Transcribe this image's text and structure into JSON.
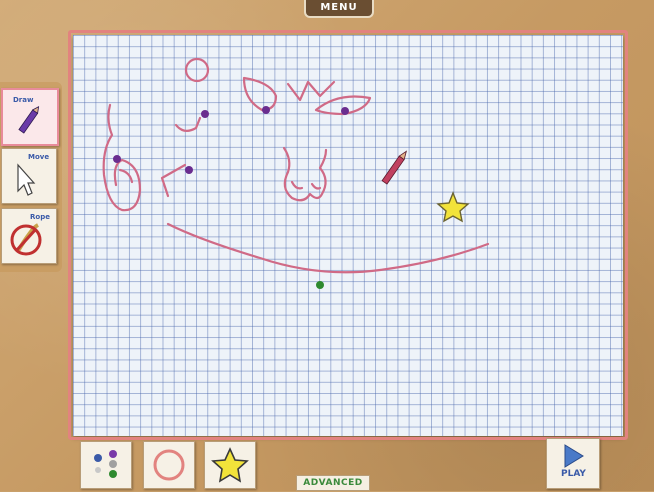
{
  "menu": {
    "label": "MENU"
  },
  "tools": {
    "draw": "Draw",
    "move": "Move",
    "rope": "Rope"
  },
  "bottom": {
    "play": "PLAY",
    "mode": "ADVANCED"
  },
  "colors": {
    "crayon": "#d06a86",
    "pin_purple": "#6a2d8f",
    "pin_green": "#2f8a2f",
    "star": "#f2e33a",
    "paper_border": "#e2837f",
    "label_blue": "#3a5aa8"
  }
}
